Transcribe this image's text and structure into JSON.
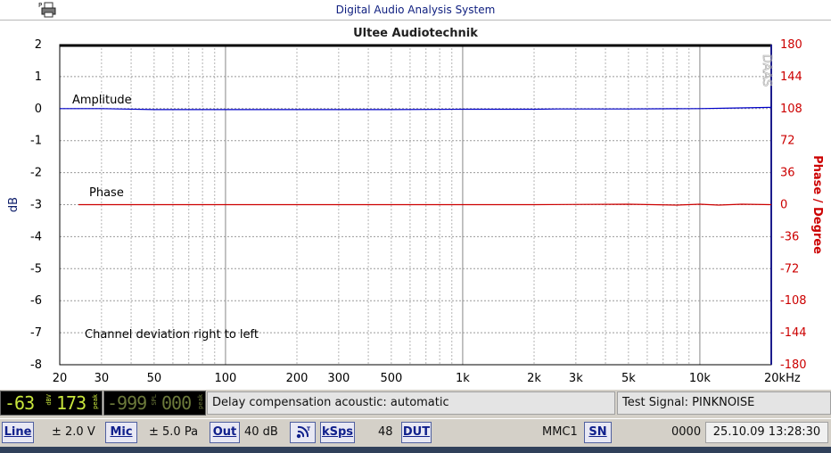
{
  "window": {
    "title": "Digital Audio Analysis System"
  },
  "chart_data": {
    "type": "line",
    "title": "Ultee Audiotechnik",
    "ylabel_left": "dB",
    "ylabel_right": "Phase / Degree",
    "xscale": "log",
    "xlim": [
      20,
      20000
    ],
    "ylim_left": [
      -8,
      2
    ],
    "ylim_right": [
      -180,
      180
    ],
    "x_ticks": [
      "20",
      "30",
      "50",
      "100",
      "200",
      "300",
      "500",
      "1k",
      "2k",
      "3k",
      "5k",
      "10k",
      "20kHz"
    ],
    "y_ticks_left": [
      "2",
      "1",
      "0",
      "-1",
      "-2",
      "-3",
      "-4",
      "-5",
      "-6",
      "-7",
      "-8"
    ],
    "y_ticks_right": [
      "180",
      "144",
      "108",
      "72",
      "36",
      "0",
      "-36",
      "-72",
      "-108",
      "-144",
      "-180"
    ],
    "grid": true,
    "annotations": [
      "Amplitude",
      "Phase",
      "Channel deviation right to left"
    ],
    "watermark": "DAAS",
    "series": [
      {
        "axis": "left",
        "color": "#0000c8",
        "x": [
          20,
          30,
          50,
          100,
          200,
          500,
          1000,
          2000,
          2500,
          5000,
          10000,
          14000,
          20000
        ],
        "values": [
          0.0,
          0.0,
          -0.03,
          -0.03,
          -0.03,
          -0.03,
          -0.02,
          -0.02,
          -0.01,
          -0.01,
          0.0,
          0.02,
          0.04
        ]
      },
      {
        "axis": "right",
        "color": "#cc0000",
        "x": [
          24,
          30,
          50,
          100,
          200,
          500,
          1000,
          2000,
          5000,
          8000,
          10000,
          12000,
          15000,
          20000
        ],
        "values": [
          0.0,
          0.0,
          0.0,
          0.0,
          0.0,
          0.0,
          0.0,
          0.0,
          0.5,
          -0.5,
          0.5,
          -0.5,
          0.5,
          0.0
        ]
      }
    ]
  },
  "meters": {
    "level1": {
      "value": "-63",
      "unit": "dBV",
      "value2": "173",
      "unit2": "peak"
    },
    "level2": {
      "value": "-999",
      "unit": "SPL",
      "value2": "000",
      "unit2": "peak"
    }
  },
  "status": {
    "delay": "Delay compensation acoustic: automatic",
    "test_signal": "Test Signal: PINKNOISE"
  },
  "controls": {
    "line_label": "Line",
    "line_value": "± 2.0 V",
    "mic_label": "Mic",
    "mic_value": "± 5.0 Pa",
    "out_label": "Out",
    "out_value": "40 dB",
    "ksps_label": "kSps",
    "ksps_value": "48",
    "dut_label": "DUT",
    "mmc": "MMC1",
    "sn_label": "SN",
    "counter": "0000",
    "datetime": "25.10.09 13:28:30"
  }
}
